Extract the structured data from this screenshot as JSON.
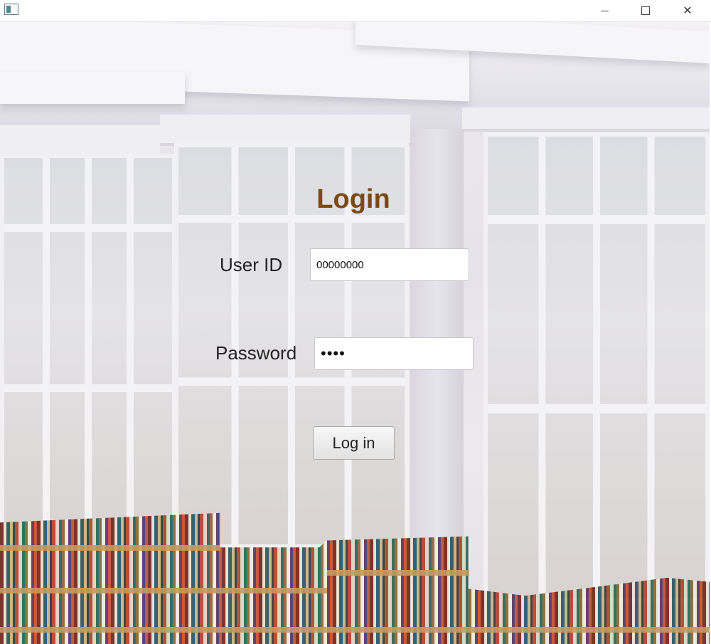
{
  "window": {
    "minimize_icon": "minimize-icon",
    "maximize_icon": "maximize-icon",
    "close_icon": "close-icon",
    "close_glyph": "✕"
  },
  "login": {
    "title": "Login",
    "user_id_label": "User ID",
    "user_id_value": "00000000",
    "password_label": "Password",
    "password_value": "••••",
    "submit_label": "Log in"
  },
  "colors": {
    "title": "#7a4a12"
  }
}
